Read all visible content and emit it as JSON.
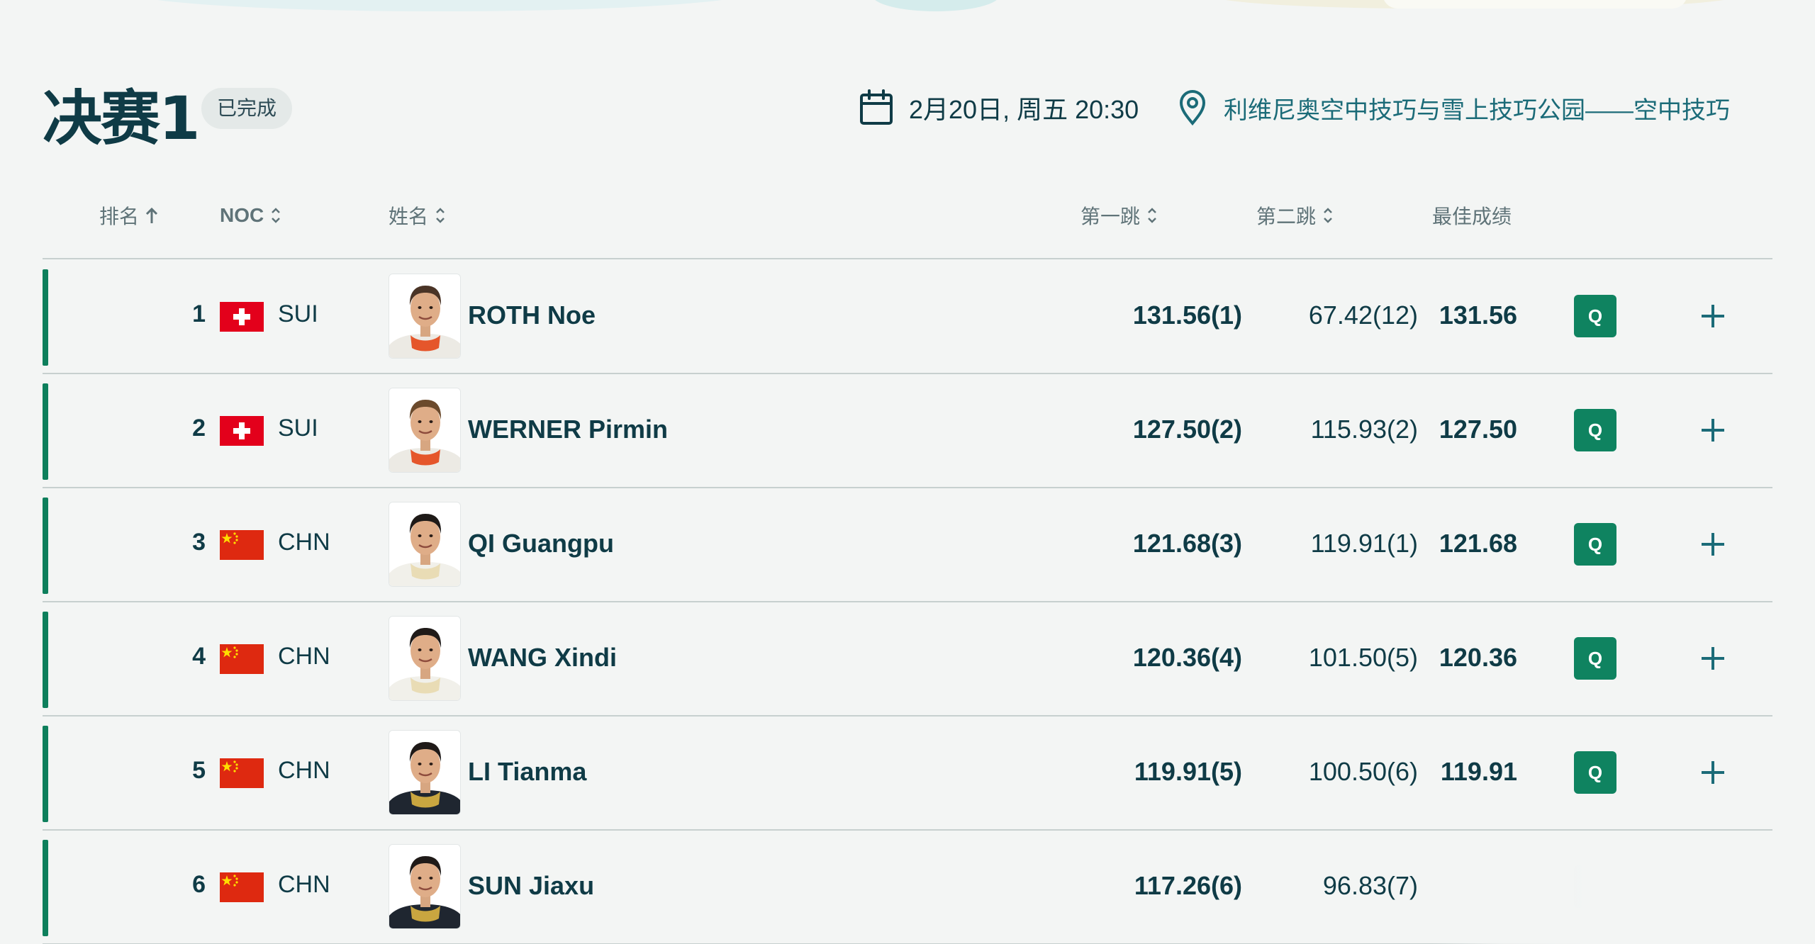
{
  "header": {
    "title": "决赛1",
    "status": "已完成",
    "datetime": "2月20日, 周五 20:30",
    "venue": "利维尼奥空中技巧与雪上技巧公园——空中技巧"
  },
  "columns": {
    "rank": "排名",
    "noc": "NOC",
    "name": "姓名",
    "jump1": "第一跳",
    "jump2": "第二跳",
    "best": "最佳成绩"
  },
  "rows": [
    {
      "rank": "1",
      "flag": "SUI",
      "noc": "SUI",
      "name": "ROTH Noe",
      "jump1": "131.56(1)",
      "jump2": "67.42(12)",
      "best": "131.56",
      "qualification": "Q",
      "expand": "+"
    },
    {
      "rank": "2",
      "flag": "SUI",
      "noc": "SUI",
      "name": "WERNER Pirmin",
      "jump1": "127.50(2)",
      "jump2": "115.93(2)",
      "best": "127.50",
      "qualification": "Q",
      "expand": "+"
    },
    {
      "rank": "3",
      "flag": "CHN",
      "noc": "CHN",
      "name": "QI Guangpu",
      "jump1": "121.68(3)",
      "jump2": "119.91(1)",
      "best": "121.68",
      "qualification": "Q",
      "expand": "+"
    },
    {
      "rank": "4",
      "flag": "CHN",
      "noc": "CHN",
      "name": "WANG Xindi",
      "jump1": "120.36(4)",
      "jump2": "101.50(5)",
      "best": "120.36",
      "qualification": "Q",
      "expand": "+"
    },
    {
      "rank": "5",
      "flag": "CHN",
      "noc": "CHN",
      "name": "LI Tianma",
      "jump1": "119.91(5)",
      "jump2": "100.50(6)",
      "best": "119.91",
      "qualification": "Q",
      "expand": "+"
    },
    {
      "rank": "6",
      "flag": "CHN",
      "noc": "CHN",
      "name": "SUN Jiaxu",
      "jump1": "117.26(6)",
      "jump2": "96.83(7)",
      "best": "",
      "qualification": "",
      "expand": ""
    }
  ],
  "colors": {
    "accent": "#0e7f5c",
    "text": "#0f3b46",
    "qualified_badge": "#0f8360",
    "background": "#f3f5f4"
  },
  "icons": [
    "calendar-icon",
    "location-pin-icon",
    "sort-up-arrow-icon",
    "sort-chevrons-icon",
    "plus-icon",
    "flag-switzerland",
    "flag-china"
  ]
}
